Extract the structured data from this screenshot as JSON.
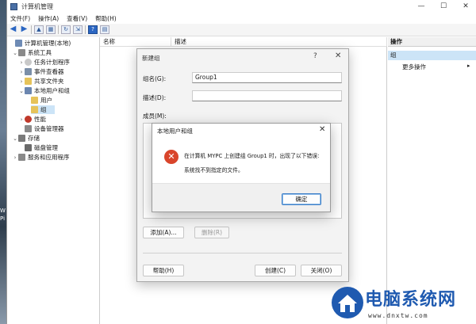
{
  "window": {
    "title": "计算机管理",
    "minimize": "—",
    "maximize": "☐",
    "close": "✕"
  },
  "menu": [
    "文件(F)",
    "操作(A)",
    "查看(V)",
    "帮助(H)"
  ],
  "desktop_text": [
    "W",
    "Pi"
  ],
  "tree": {
    "root": "计算机管理(本地)",
    "system_tools": "系统工具",
    "task_scheduler": "任务计划程序",
    "event_viewer": "事件查看器",
    "shared_folders": "共享文件夹",
    "local_users_groups": "本地用户和组",
    "users": "用户",
    "groups": "组",
    "performance": "性能",
    "device_manager": "设备管理器",
    "storage": "存储",
    "disk_management": "磁盘管理",
    "services_apps": "服务和应用程序"
  },
  "list": {
    "col_name": "名称",
    "col_desc": "描述"
  },
  "actions": {
    "header": "操作",
    "selected": "组",
    "more": "更多操作",
    "more_arrow": "▸"
  },
  "new_group_dialog": {
    "title": "新建组",
    "help": "?",
    "close": "✕",
    "name_label": "组名(G):",
    "name_value": "Group1",
    "desc_label": "描述(D):",
    "desc_value": "",
    "members_label": "成员(M):",
    "add_button": "添加(A)...",
    "remove_button": "删除(R)",
    "help_button": "帮助(H)",
    "create_button": "创建(C)",
    "close_button": "关闭(O)"
  },
  "error_dialog": {
    "title": "本地用户和组",
    "close": "✕",
    "icon": "✕",
    "message": "在计算机 MYPC 上创建组 Group1 时，出现了以下错误:",
    "detail": "系统找不到指定的文件。",
    "ok_button": "确定"
  },
  "watermark": {
    "title": "电脑系统网",
    "url": "www.dnxtw.com"
  },
  "colors": {
    "accent": "#2b66c2",
    "error": "#d9452b",
    "selection": "#cce4f7",
    "watermark": "#1f5ab0"
  }
}
